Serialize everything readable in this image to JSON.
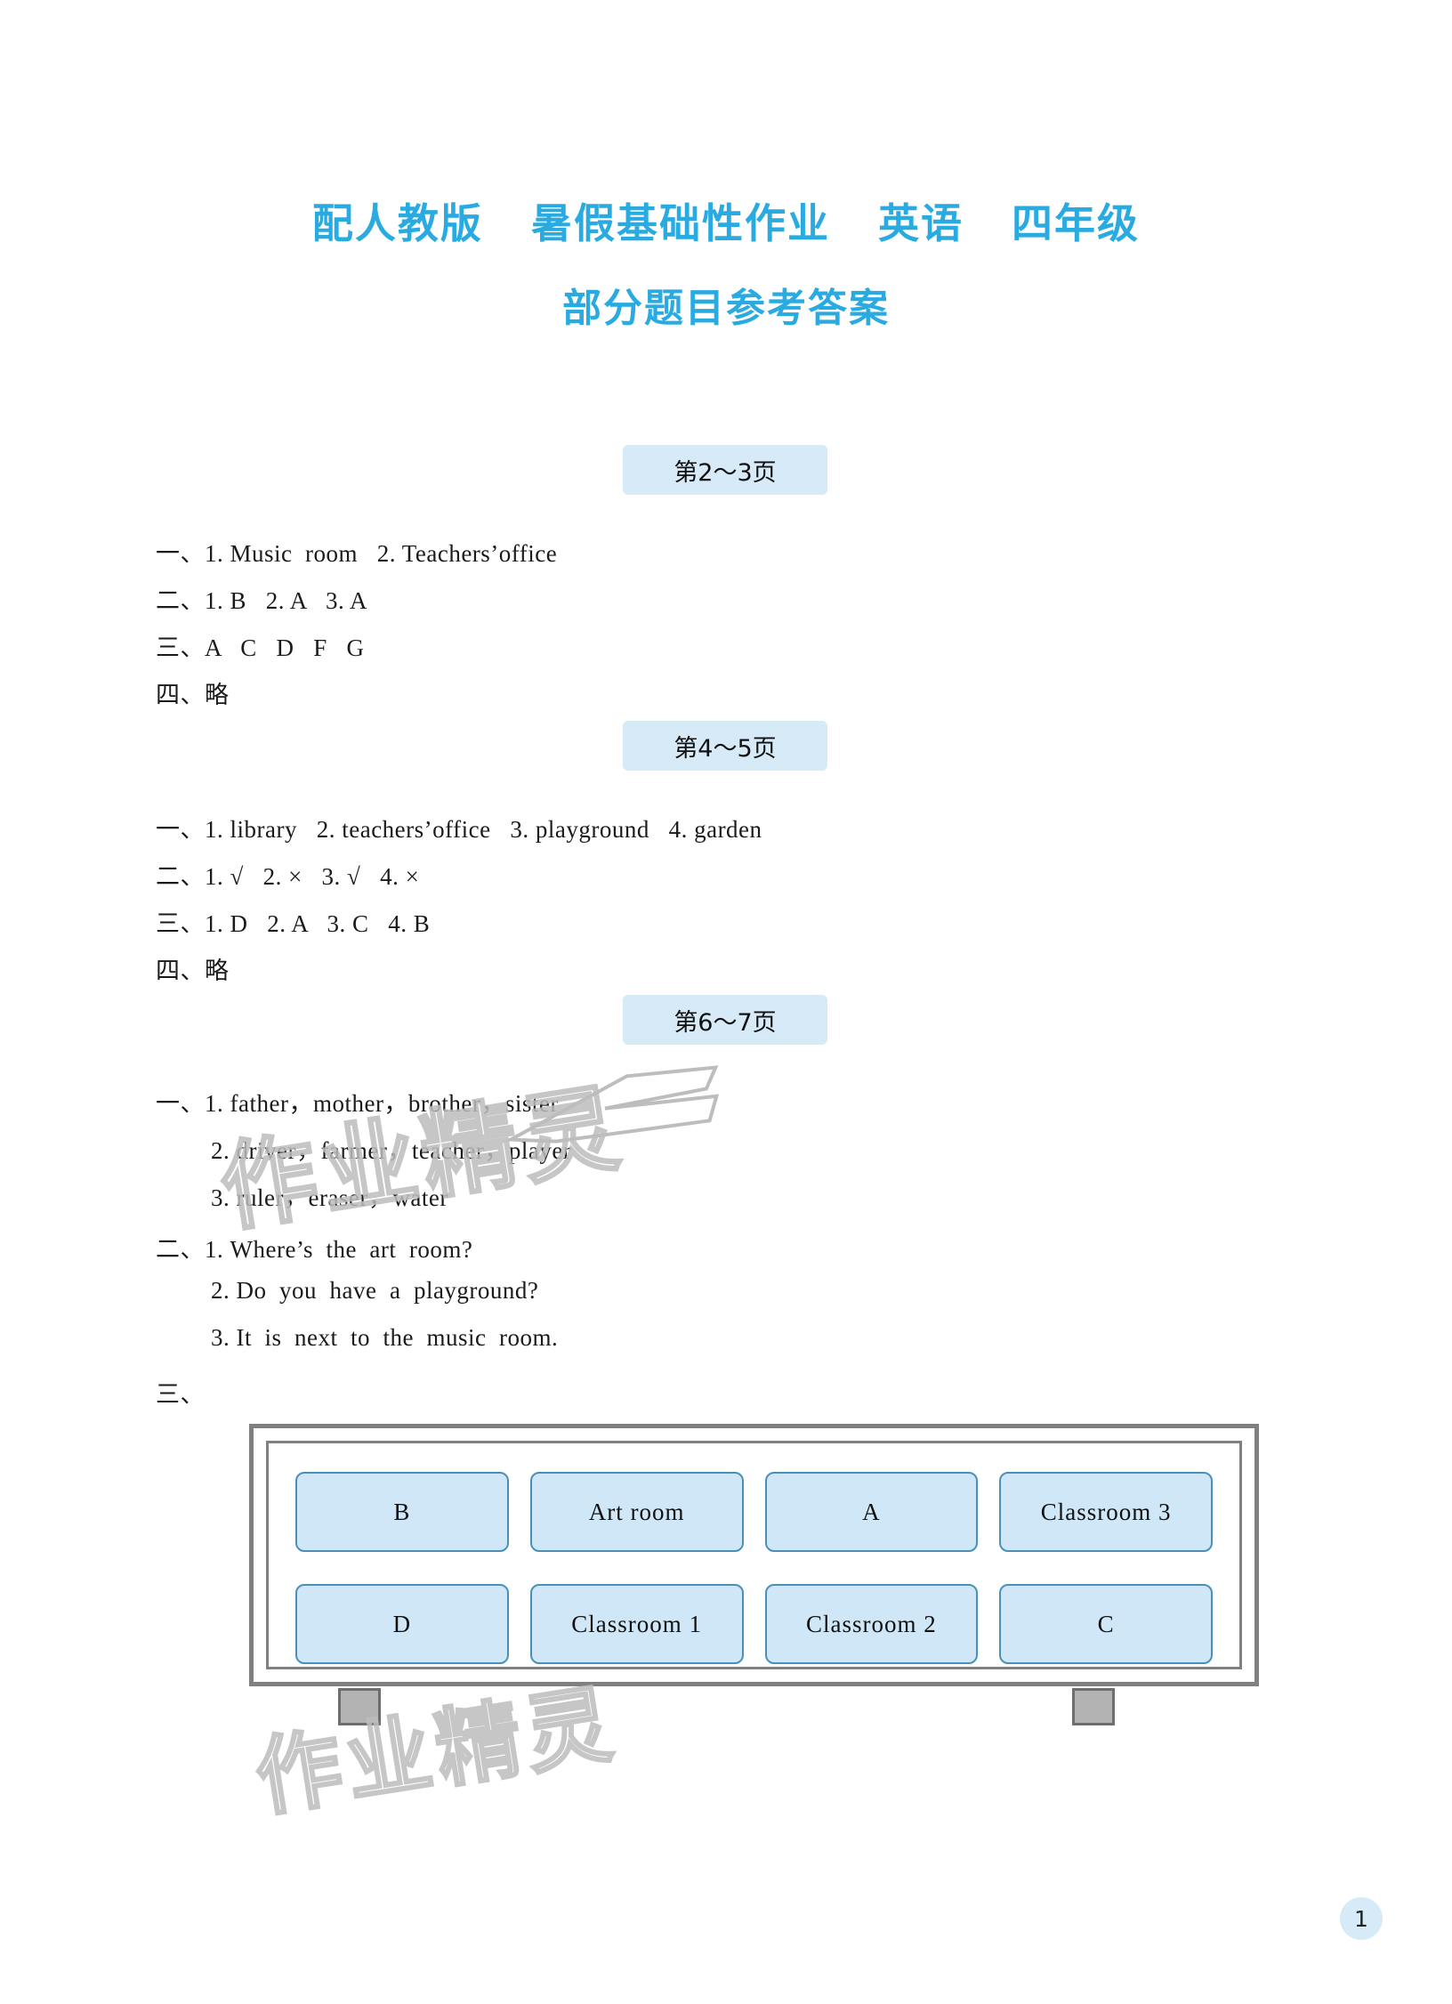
{
  "doc": {
    "title_main": "配人教版   暑假基础性作业   英语   四年级",
    "title_sub": "部分题目参考答案",
    "page_number": "1",
    "accent_color": "#29abe2",
    "chip_color": "#d6eaf8"
  },
  "watermarks": {
    "one": "作业精灵",
    "two": "作业精灵"
  },
  "sections": [
    {
      "chip": "第2～3页",
      "lines": [
        "一、1. Music  room   2. Teachers’office",
        "二、1. B   2. A   3. A",
        "三、A   C   D   F   G",
        "四、略"
      ]
    },
    {
      "chip": "第4～5页",
      "lines": [
        "一、1. library   2. teachers’office   3. playground   4. garden",
        "二、1. √   2. ×   3. √   4. ×",
        "三、1. D   2. A   3. C   4. B",
        "四、略"
      ]
    },
    {
      "chip": "第6～7页",
      "lines": [
        "一、1. father，mother，brother，sister",
        "2. driver，farmer，teacher，player",
        "3. ruler，eraser，water",
        "二、1. Where’s  the  art  room?",
        "2. Do  you  have  a  playground?",
        "3. It  is  next  to  the  music  room.",
        "三、"
      ]
    }
  ],
  "diagram": {
    "row1": [
      "B",
      "Art  room",
      "A",
      "Classroom  3"
    ],
    "row2": [
      "D",
      "Classroom  1",
      "Classroom  2",
      "C"
    ]
  }
}
